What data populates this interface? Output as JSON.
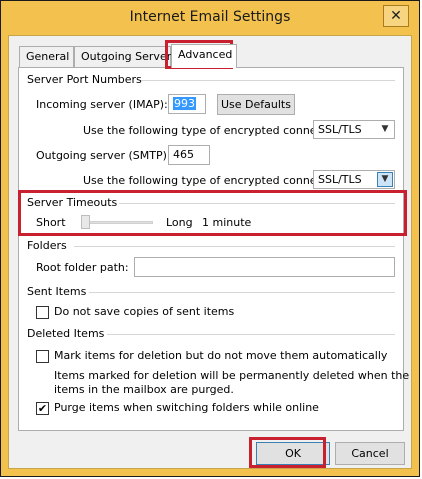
{
  "window": {
    "title": "Internet Email Settings",
    "close_glyph": "✕"
  },
  "tabs": [
    {
      "label": "General"
    },
    {
      "label": "Outgoing Server"
    },
    {
      "label": "Advanced"
    }
  ],
  "server_ports": {
    "title": "Server Port Numbers",
    "incoming_label": "Incoming server (IMAP):",
    "incoming_value": "993",
    "use_defaults": "Use Defaults",
    "enc_label_1": "Use the following type of encrypted connection:",
    "enc_value_1": "SSL/TLS",
    "outgoing_label": "Outgoing server (SMTP):",
    "outgoing_value": "465",
    "enc_label_2": "Use the following type of encrypted connection:",
    "enc_value_2": "SSL/TLS"
  },
  "timeouts": {
    "title": "Server Timeouts",
    "short": "Short",
    "long": "Long",
    "value": "1 minute",
    "slider_position": 0.0
  },
  "folders": {
    "title": "Folders",
    "root_label": "Root folder path:",
    "root_value": ""
  },
  "sent_items": {
    "title": "Sent Items",
    "no_copies_label": "Do not save copies of sent items",
    "no_copies_checked": false
  },
  "deleted_items": {
    "title": "Deleted Items",
    "mark_label": "Mark items for deletion but do not move them automatically",
    "mark_checked": false,
    "note_line1": "Items marked for deletion will be permanently deleted when the",
    "note_line2": "items in the mailbox are purged.",
    "purge_label": "Purge items when switching folders while online",
    "purge_checked": true
  },
  "footer": {
    "ok": "OK",
    "cancel": "Cancel"
  },
  "check_glyph": "✔",
  "dropdown_glyph": "▼",
  "accent_highlight": "#c8202f"
}
